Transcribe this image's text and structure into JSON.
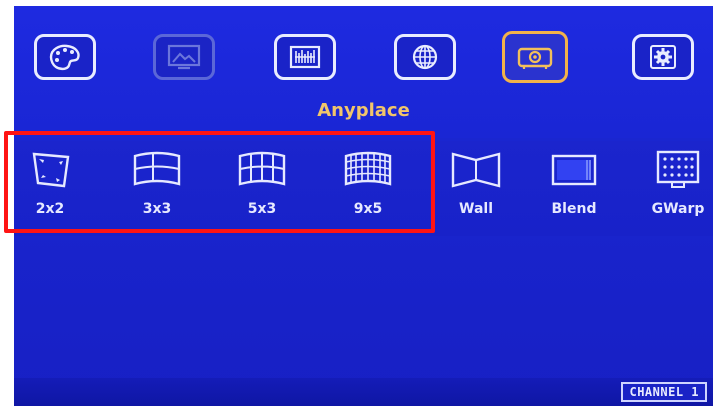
{
  "toolbar": {
    "items": [
      {
        "icon": "palette-icon",
        "state": "normal"
      },
      {
        "icon": "picture-settings-icon",
        "state": "disabled"
      },
      {
        "icon": "equalizer-icon",
        "state": "normal"
      },
      {
        "icon": "globe-icon",
        "state": "normal"
      },
      {
        "icon": "projector-icon",
        "state": "selected"
      },
      {
        "icon": "gear-icon",
        "state": "normal"
      }
    ],
    "accent_color": "#f2b24a"
  },
  "section": {
    "title": "Anyplace"
  },
  "modes": [
    {
      "label": "2x2",
      "icon": "quad-warp-icon"
    },
    {
      "label": "3x3",
      "icon": "grid-3x3-curve-icon"
    },
    {
      "label": "5x3",
      "icon": "grid-5x3-curve-icon"
    },
    {
      "label": "9x5",
      "icon": "grid-9x5-curve-icon"
    },
    {
      "label": "Wall",
      "icon": "wall-icon"
    },
    {
      "label": "Blend",
      "icon": "blend-icon"
    },
    {
      "label": "GWarp",
      "icon": "grid-warp-icon"
    }
  ],
  "highlight": {
    "color": "#ff1414"
  },
  "status": {
    "channel": "CHANNEL 1"
  }
}
